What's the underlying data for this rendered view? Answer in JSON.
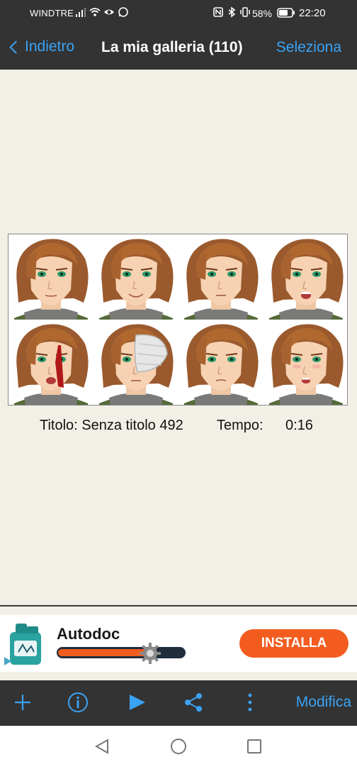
{
  "status_bar": {
    "carrier": "WINDTRE",
    "battery_percent": "58%",
    "time": "22:20",
    "icons": [
      "signal-icon",
      "wifi-icon",
      "eye-icon",
      "whatsapp-icon",
      "nfc-icon",
      "bluetooth-icon",
      "vibrate-icon",
      "battery-icon"
    ]
  },
  "nav": {
    "back_label": "Indietro",
    "title": "La mia galleria (110)",
    "select_label": "Seleziona"
  },
  "artwork": {
    "caption_title": "Titolo: Senza titolo 492",
    "time_label": "Tempo:",
    "time_value": "0:16"
  },
  "ad": {
    "app_name": "Autodoc",
    "install_label": "INSTALLA",
    "progress": 0.7,
    "colors": {
      "accent": "#f25c1f",
      "track": "#1f2d3d"
    }
  },
  "toolbar": {
    "items": [
      "add-icon",
      "info-icon",
      "play-icon",
      "share-icon",
      "more-icon"
    ],
    "edit_label": "Modifica"
  },
  "system_nav": {
    "items": [
      "back-triangle-icon",
      "home-circle-icon",
      "recents-square-icon"
    ]
  },
  "colors": {
    "bar_bg": "#333333",
    "link": "#3aa3f5",
    "page_bg": "#f2f0e6"
  }
}
